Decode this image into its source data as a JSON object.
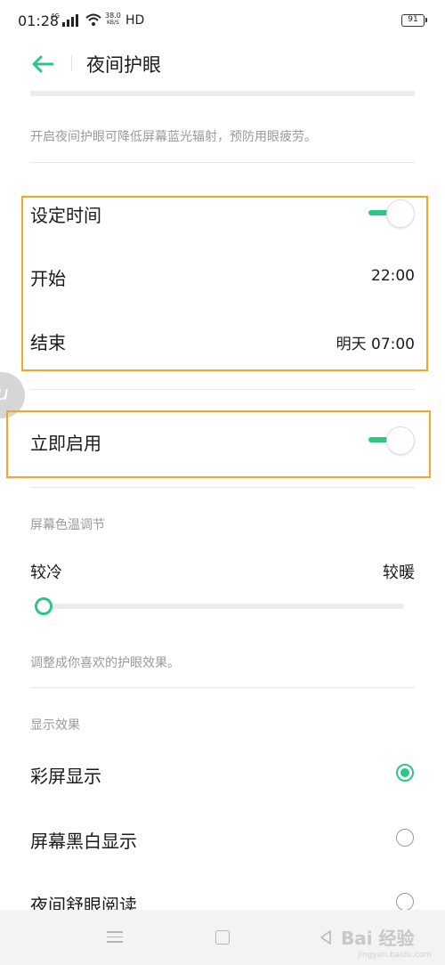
{
  "status_bar": {
    "time": "01:28",
    "network_type": "4G",
    "speed_value": "38.0",
    "speed_unit": "KB/S",
    "hd_label": "HD",
    "battery": "91"
  },
  "header": {
    "title": "夜间护眼",
    "back_icon": "arrow-left-icon"
  },
  "description": "开启夜间护眼可降低屏幕蓝光辐射，预防用眼疲劳。",
  "schedule": {
    "set_time_label": "设定时间",
    "set_time_enabled": true,
    "start_label": "开始",
    "start_value": "22:00",
    "end_label": "结束",
    "end_value": "明天 07:00"
  },
  "enable_now": {
    "label": "立即启用",
    "enabled": true
  },
  "color_temperature": {
    "section_title": "屏幕色温调节",
    "cool_label": "较冷",
    "warm_label": "较暖",
    "level": 0,
    "hint": "调整成你喜欢的护眼效果。"
  },
  "display_effect": {
    "section_title": "显示效果",
    "options": [
      {
        "label": "彩屏显示",
        "selected": true
      },
      {
        "label": "屏幕黑白显示",
        "selected": false
      },
      {
        "label": "夜间舒眼阅读",
        "selected": false
      }
    ]
  },
  "colors": {
    "accent": "#2dc784",
    "highlight": "#f6a623"
  },
  "watermark": {
    "text": "Bai 经验",
    "url": "jingyan.baidu.com"
  }
}
